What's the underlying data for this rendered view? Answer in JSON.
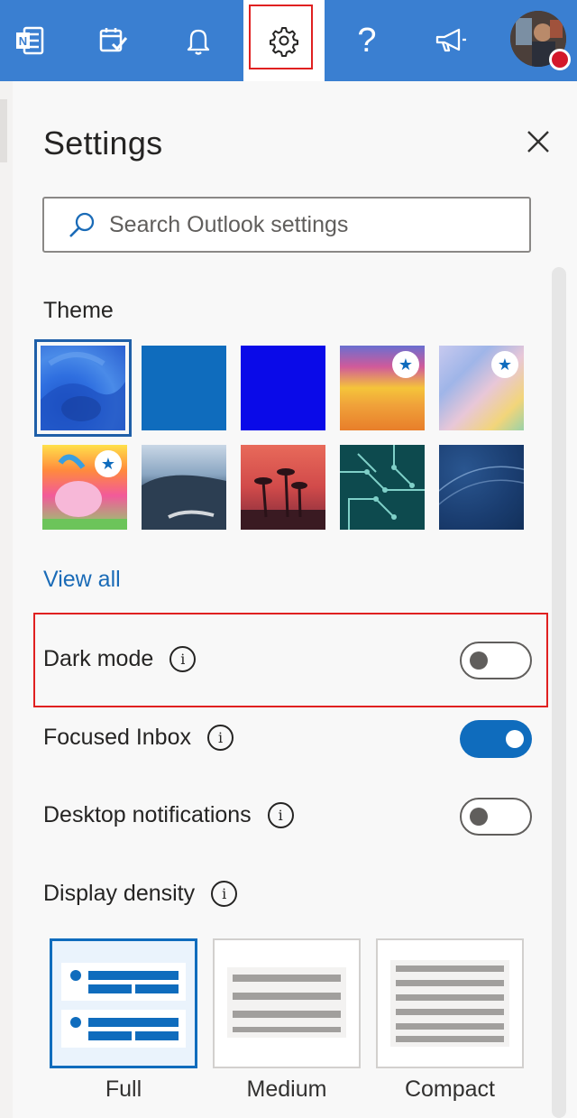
{
  "topbar": {
    "icons": [
      "onenote-icon",
      "todo-icon",
      "bell-icon",
      "gear-icon",
      "help-icon",
      "megaphone-icon",
      "avatar"
    ],
    "help_glyph": "?"
  },
  "settings": {
    "title": "Settings",
    "search_placeholder": "Search Outlook settings",
    "theme_label": "Theme",
    "themes": [
      {
        "name": "blue-abstract",
        "selected": true,
        "premium": false
      },
      {
        "name": "solid-blue",
        "selected": false,
        "premium": false
      },
      {
        "name": "bright-blue",
        "selected": false,
        "premium": false
      },
      {
        "name": "rainbow-waves",
        "selected": false,
        "premium": true
      },
      {
        "name": "ribbons",
        "selected": false,
        "premium": true
      },
      {
        "name": "unicorn",
        "selected": false,
        "premium": true
      },
      {
        "name": "coast",
        "selected": false,
        "premium": false
      },
      {
        "name": "palms",
        "selected": false,
        "premium": false
      },
      {
        "name": "circuit",
        "selected": false,
        "premium": false
      },
      {
        "name": "elevation",
        "selected": false,
        "premium": false
      }
    ],
    "view_all": "View all",
    "dark_mode": {
      "label": "Dark mode",
      "on": false
    },
    "focused_inbox": {
      "label": "Focused Inbox",
      "on": true
    },
    "desktop_notifications": {
      "label": "Desktop notifications",
      "on": false
    },
    "display_density": {
      "label": "Display density",
      "options": [
        "Full",
        "Medium",
        "Compact"
      ],
      "selected": "Full"
    },
    "info_glyph": "i",
    "star_glyph": "★"
  },
  "colors": {
    "topbar": "#3a7fd1",
    "accent": "#0f6cbd",
    "highlight": "#e02020"
  }
}
